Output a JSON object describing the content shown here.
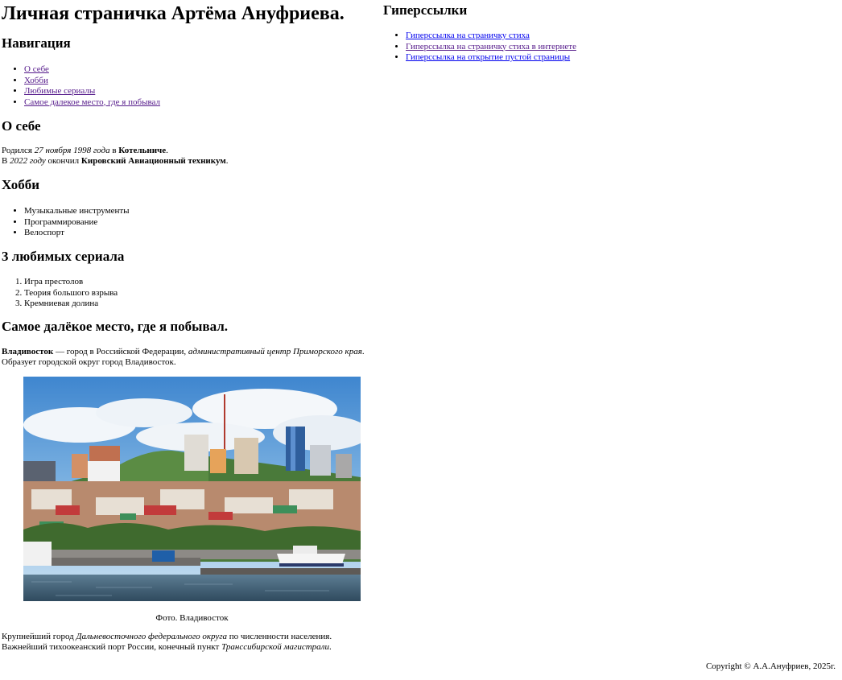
{
  "page_title": "Личная страничка Артёма Ануфриева.",
  "navigation": {
    "heading": "Навигация",
    "links": [
      "О себе",
      "Хобби",
      "Любимые сериалы",
      "Самое далекое место, где я побывал"
    ]
  },
  "about": {
    "heading": "О себе",
    "line1": {
      "t1": "Родился ",
      "em1": "27 ноября 1998 года",
      "t2": " в ",
      "b1": "Котельниче",
      "t3": "."
    },
    "line2": {
      "t1": "В ",
      "em1": "2022 году",
      "t2": " окончил ",
      "b1": "Кировский Авиационный техникум",
      "t3": "."
    }
  },
  "hobby": {
    "heading": "Хобби",
    "items": [
      "Музыкальные инструменты",
      "Программирование",
      "Велоспорт"
    ]
  },
  "series": {
    "heading": "3 любимых сериала",
    "items": [
      "Игра престолов",
      "Теория большого взрыва",
      "Кремниевая долина"
    ]
  },
  "place": {
    "heading": "Самое далёкое место, где я побывал.",
    "p1_line1": {
      "b1": "Владивосток",
      "t1": " — город в Российской Федерации, ",
      "em1": "административный центр Приморского края",
      "t2": "."
    },
    "p1_line2": "Образует городской округ город Владивосток.",
    "photo_caption": "Фото. Владивосток",
    "p2_line1": {
      "t1": "Крупнейший город ",
      "em1": "Дальневосточного федерального округа",
      "t2": " по численности населения."
    },
    "p2_line2": {
      "t1": "Важнейший тихоокеанский порт России, конечный пункт ",
      "em1": "Транссибирской магистрали",
      "t2": "."
    }
  },
  "hyperlinks": {
    "heading": "Гиперссылки",
    "links": [
      "Гиперссылка на страничку стиха",
      "Гиперссылка на страничку стиха в интернете",
      "Гиперссылка на открытие пустой страницы"
    ]
  },
  "footer": "Copyright © А.А.Ануфриев, 2025г.",
  "colors": {
    "link": "#0000ee",
    "visited_link": "#551a8b"
  }
}
